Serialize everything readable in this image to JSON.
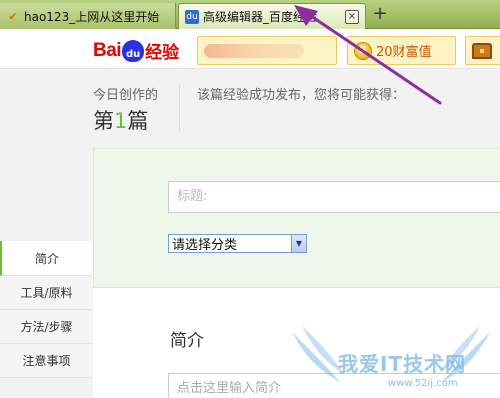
{
  "browser": {
    "tabs": [
      {
        "favicon": "hao123-icon",
        "title": "hao123_上网从这里开始",
        "close": "×"
      },
      {
        "favicon": "du",
        "title": "高级编辑器_百度经验",
        "close": "×"
      }
    ],
    "new_tab": "+"
  },
  "header": {
    "logo_bai": "Bai",
    "logo_du": "du",
    "logo_jingyan": "经验"
  },
  "stats": {
    "today_label": "今日创作的",
    "today_prefix": "第",
    "today_count": "1",
    "today_suffix": "篇",
    "reward_label": "该篇经验成功发布，您将可能获得：",
    "reward_wealth": "20财富值",
    "coin_symbol": "S"
  },
  "form": {
    "title_placeholder": "标题:",
    "category_value": "请选择分类",
    "intro_heading": "简介",
    "intro_placeholder": "点击这里输入简介"
  },
  "leftnav": {
    "items": [
      {
        "label": "简介",
        "active": true
      },
      {
        "label": "工具/原料",
        "active": false
      },
      {
        "label": "方法/步骤",
        "active": false
      },
      {
        "label": "注意事项",
        "active": false
      }
    ]
  },
  "watermark": {
    "text": "我爱IT技术网",
    "url": "www.52ij.com"
  },
  "colors": {
    "tabbar": "#93b04f",
    "accent_green": "#6cbb3c",
    "annotation_arrow": "#8a2fa0",
    "baidu_red": "#e10601",
    "baidu_blue": "#2932e1"
  }
}
